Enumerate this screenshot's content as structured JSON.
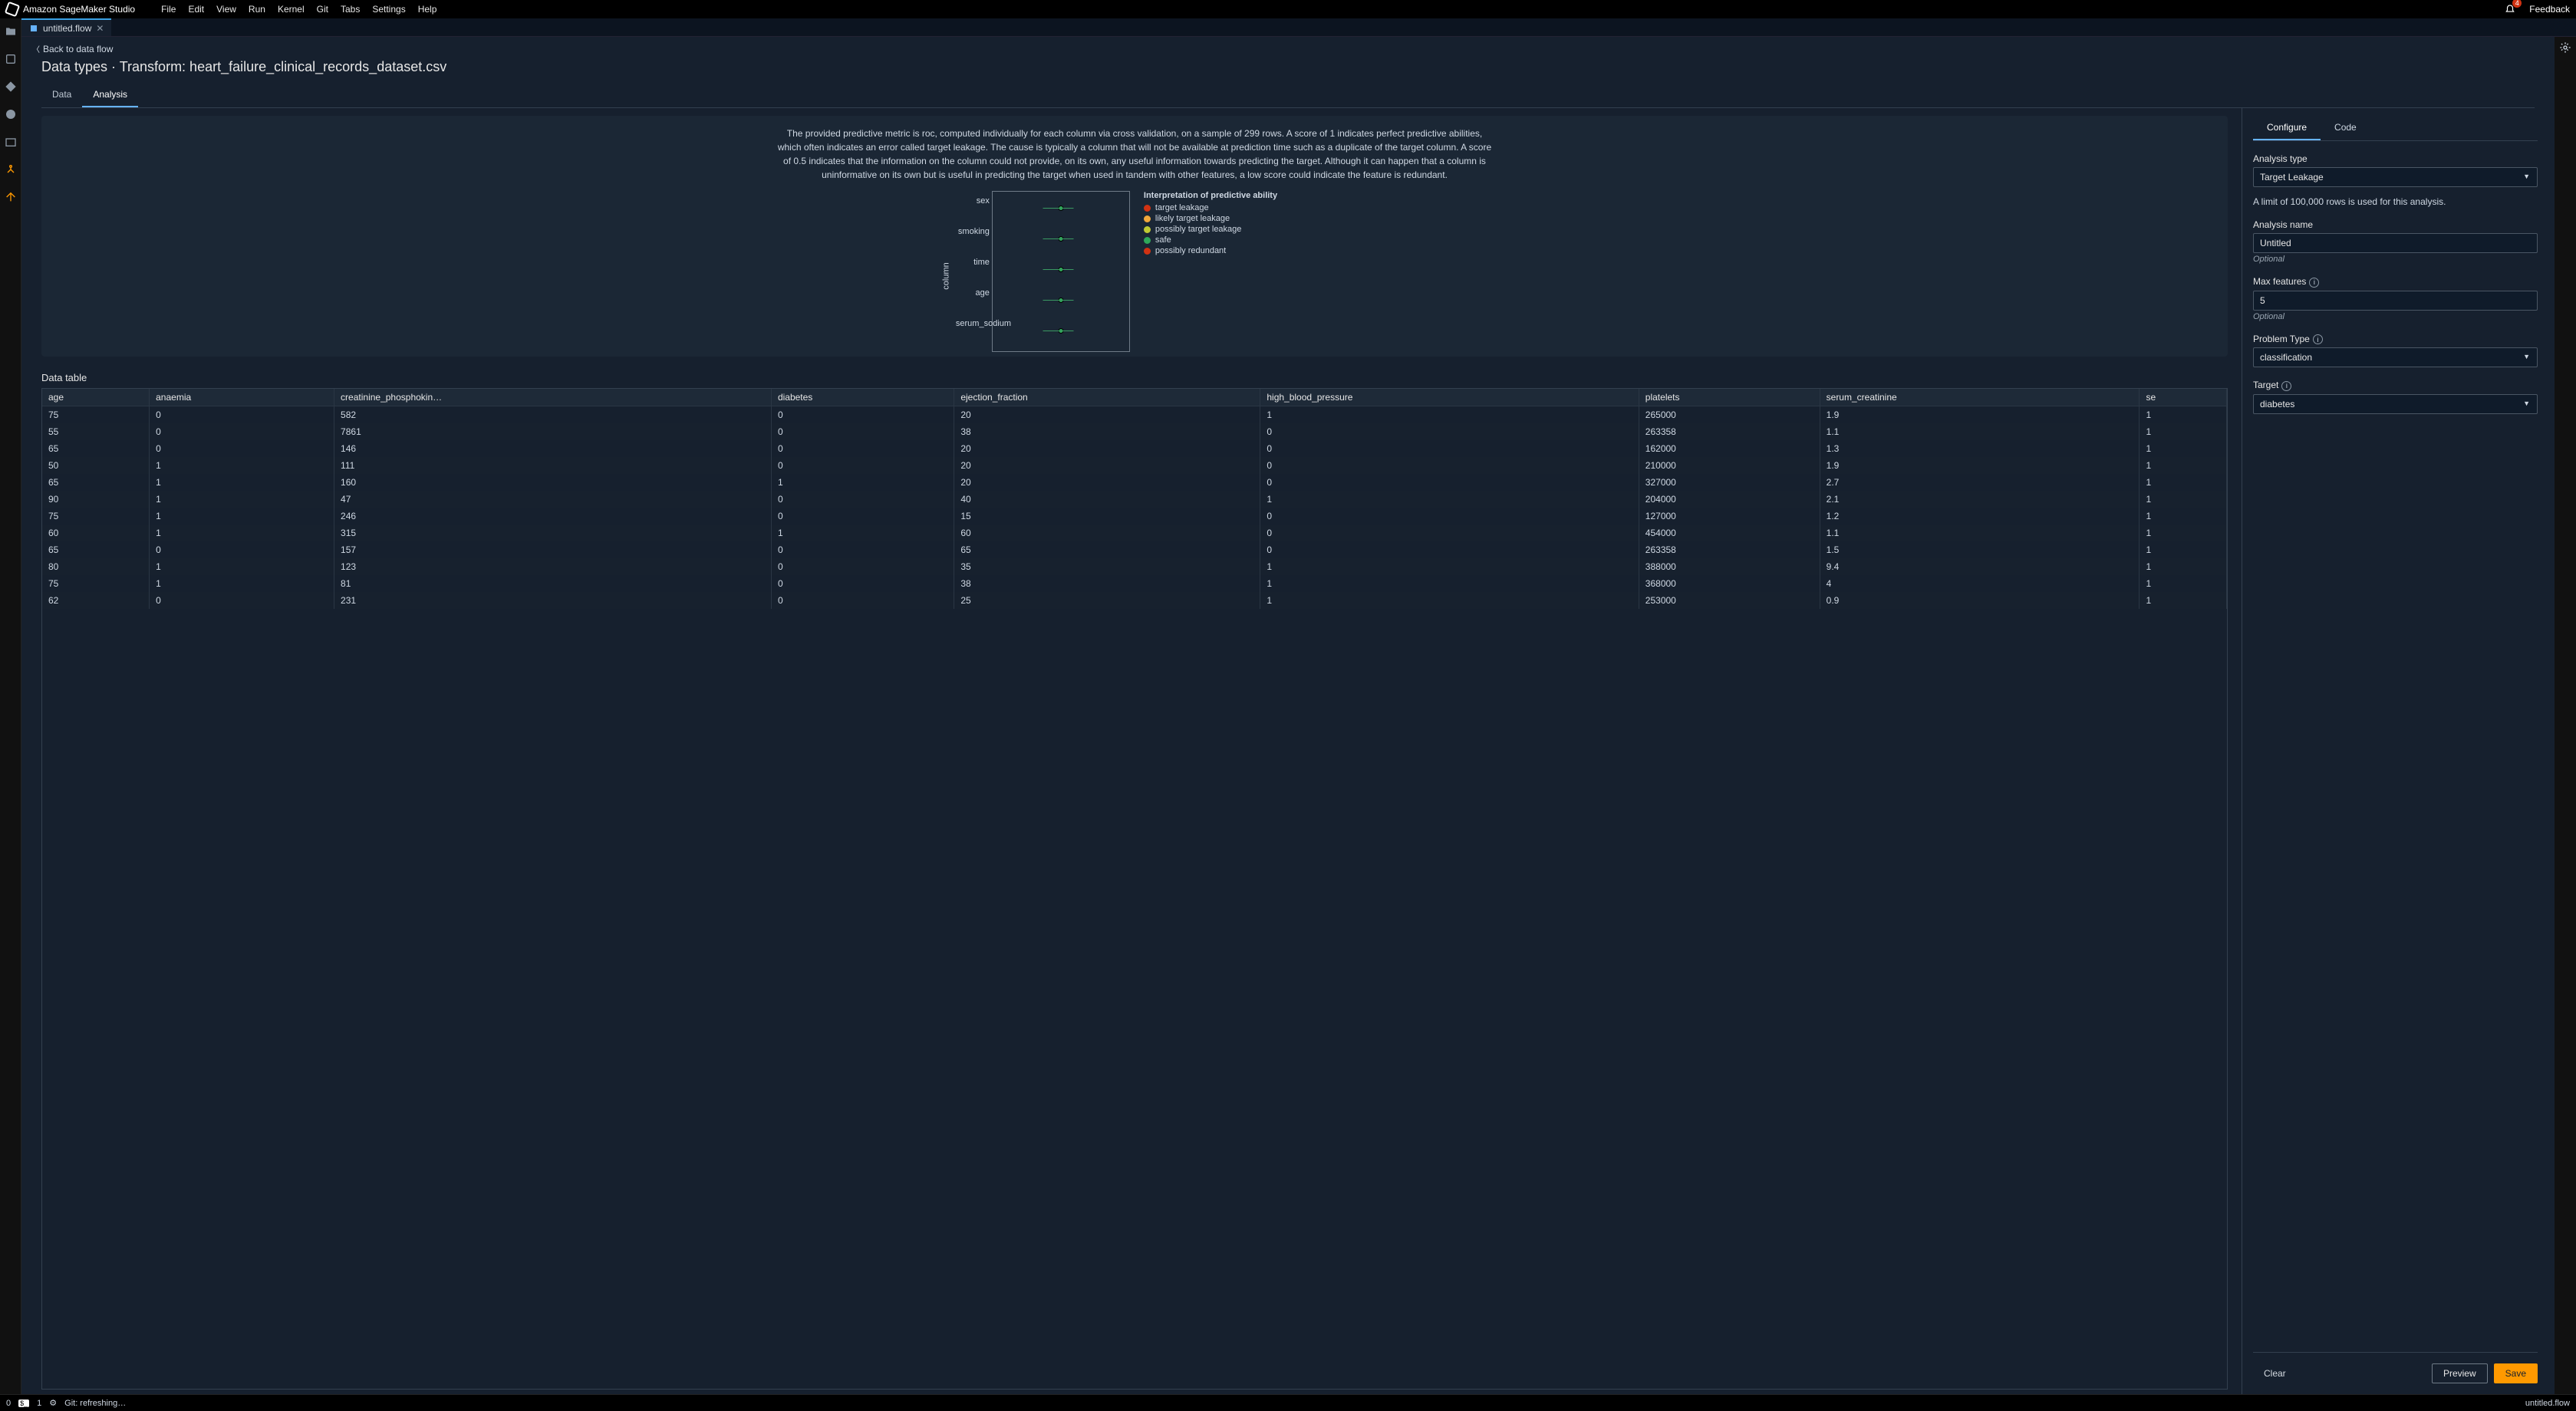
{
  "header": {
    "brand": "Amazon SageMaker Studio",
    "menus": [
      "File",
      "Edit",
      "View",
      "Run",
      "Kernel",
      "Git",
      "Tabs",
      "Settings",
      "Help"
    ],
    "notif_count": "4",
    "feedback": "Feedback"
  },
  "tab": {
    "filename": "untitled.flow"
  },
  "page": {
    "back": "Back to data flow",
    "title": "Data types · Transform: heart_failure_clinical_records_dataset.csv",
    "subtabs": {
      "data": "Data",
      "analysis": "Analysis"
    }
  },
  "analysis": {
    "description": "The provided predictive metric is roc, computed individually for each column via cross validation, on a sample of 299 rows. A score of 1 indicates perfect predictive abilities, which often indicates an error called target leakage. The cause is typically a column that will not be available at prediction time such as a duplicate of the target column. A score of 0.5 indicates that the information on the column could not provide, on its own, any useful information towards predicting the target. Although it can happen that a column is uninformative on its own but is useful in predicting the target when used in tandem with other features, a low score could indicate the feature is redundant."
  },
  "chart_data": {
    "type": "scatter",
    "title": "Interpretation of predictive ability",
    "ylabel": "column",
    "categories": [
      "sex",
      "smoking",
      "time",
      "age",
      "serum_sodium"
    ],
    "x": [
      0.5,
      0.5,
      0.5,
      0.5,
      0.5
    ],
    "xlim": [
      0,
      1
    ],
    "legend": [
      {
        "label": "target leakage",
        "color": "#d13212"
      },
      {
        "label": "likely target leakage",
        "color": "#f2a83b"
      },
      {
        "label": "possibly target leakage",
        "color": "#c0ca33"
      },
      {
        "label": "safe",
        "color": "#2fa85a"
      },
      {
        "label": "possibly redundant",
        "color": "#d13212"
      }
    ]
  },
  "table": {
    "title": "Data table",
    "columns": [
      "age",
      "anaemia",
      "creatinine_phosphokin…",
      "diabetes",
      "ejection_fraction",
      "high_blood_pressure",
      "platelets",
      "serum_creatinine",
      "se"
    ],
    "rows": [
      [
        "75",
        "0",
        "582",
        "0",
        "20",
        "1",
        "265000",
        "1.9",
        "1"
      ],
      [
        "55",
        "0",
        "7861",
        "0",
        "38",
        "0",
        "263358",
        "1.1",
        "1"
      ],
      [
        "65",
        "0",
        "146",
        "0",
        "20",
        "0",
        "162000",
        "1.3",
        "1"
      ],
      [
        "50",
        "1",
        "111",
        "0",
        "20",
        "0",
        "210000",
        "1.9",
        "1"
      ],
      [
        "65",
        "1",
        "160",
        "1",
        "20",
        "0",
        "327000",
        "2.7",
        "1"
      ],
      [
        "90",
        "1",
        "47",
        "0",
        "40",
        "1",
        "204000",
        "2.1",
        "1"
      ],
      [
        "75",
        "1",
        "246",
        "0",
        "15",
        "0",
        "127000",
        "1.2",
        "1"
      ],
      [
        "60",
        "1",
        "315",
        "1",
        "60",
        "0",
        "454000",
        "1.1",
        "1"
      ],
      [
        "65",
        "0",
        "157",
        "0",
        "65",
        "0",
        "263358",
        "1.5",
        "1"
      ],
      [
        "80",
        "1",
        "123",
        "0",
        "35",
        "1",
        "388000",
        "9.4",
        "1"
      ],
      [
        "75",
        "1",
        "81",
        "0",
        "38",
        "1",
        "368000",
        "4",
        "1"
      ],
      [
        "62",
        "0",
        "231",
        "0",
        "25",
        "1",
        "253000",
        "0.9",
        "1"
      ]
    ]
  },
  "config": {
    "tabs": {
      "configure": "Configure",
      "code": "Code"
    },
    "analysis_type_label": "Analysis type",
    "analysis_type_value": "Target Leakage",
    "rows_note": "A limit of 100,000 rows is used for this analysis.",
    "analysis_name_label": "Analysis name",
    "analysis_name_value": "Untitled",
    "optional": "Optional",
    "max_features_label": "Max features",
    "max_features_value": "5",
    "problem_type_label": "Problem Type",
    "problem_type_value": "classification",
    "target_label": "Target",
    "target_value": "diabetes",
    "clear": "Clear",
    "preview": "Preview",
    "save": "Save"
  },
  "status": {
    "left0": "0",
    "left1": "1",
    "git": "Git: refreshing…",
    "right": "untitled.flow"
  }
}
